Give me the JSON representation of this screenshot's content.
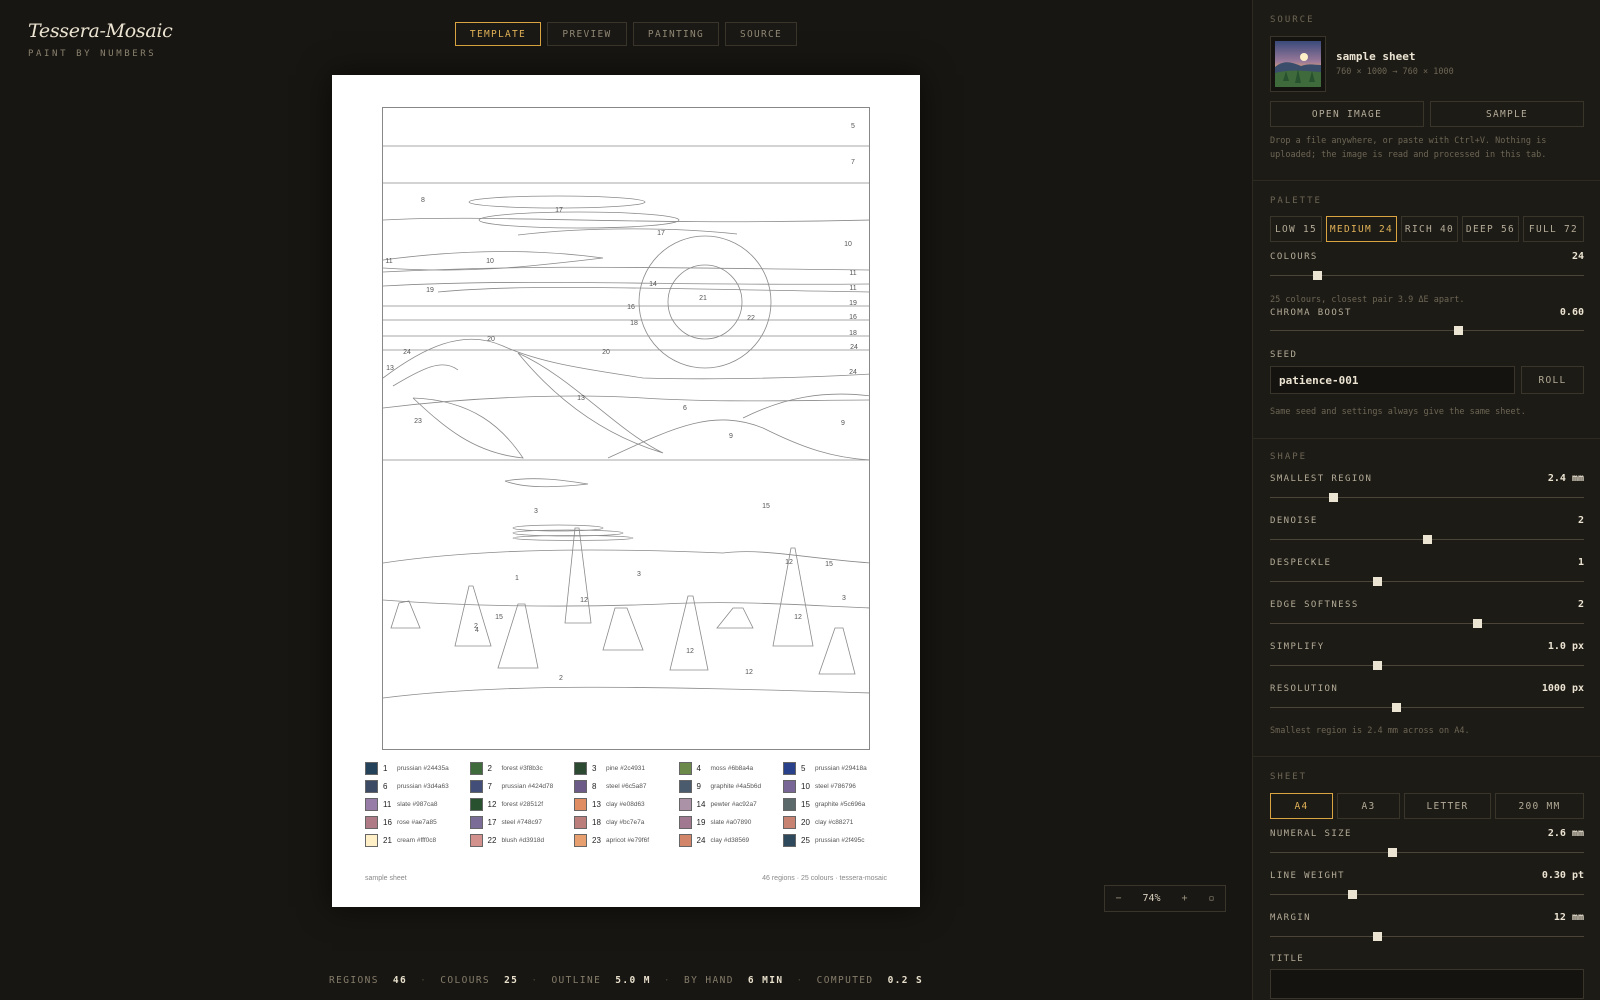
{
  "brand": {
    "title": "Tessera-Mosaic",
    "subtitle": "PAINT BY NUMBERS"
  },
  "tabs": [
    {
      "label": "TEMPLATE",
      "active": true
    },
    {
      "label": "PREVIEW",
      "active": false
    },
    {
      "label": "PAINTING",
      "active": false
    },
    {
      "label": "SOURCE",
      "active": false
    }
  ],
  "sheet": {
    "region_numbers": [
      "5",
      "7",
      "8",
      "17",
      "10",
      "11",
      "10",
      "11",
      "17",
      "14",
      "21",
      "11",
      "19",
      "19",
      "16",
      "16",
      "18",
      "18",
      "22",
      "20",
      "24",
      "24",
      "20",
      "13",
      "24",
      "13",
      "6",
      "23",
      "9",
      "9",
      "15",
      "1",
      "3",
      "3",
      "12",
      "15",
      "15",
      "2",
      "12",
      "12",
      "3",
      "12",
      "12",
      "2",
      "4"
    ],
    "legend": [
      {
        "num": "1",
        "label": "prussian #24435a",
        "color": "#24435a"
      },
      {
        "num": "2",
        "label": "forest #3f8b3c",
        "color": "#3f6b3c"
      },
      {
        "num": "3",
        "label": "pine #2c4931",
        "color": "#2c4931"
      },
      {
        "num": "4",
        "label": "moss #6b8a4a",
        "color": "#6b8a4a"
      },
      {
        "num": "5",
        "label": "prussian #29418a",
        "color": "#29418a"
      },
      {
        "num": "6",
        "label": "prussian #3d4a63",
        "color": "#3d4a63"
      },
      {
        "num": "7",
        "label": "prussian #424d78",
        "color": "#424d78"
      },
      {
        "num": "8",
        "label": "steel #6c5a87",
        "color": "#6c5a87"
      },
      {
        "num": "9",
        "label": "graphite #4a5b6d",
        "color": "#4a5b6d"
      },
      {
        "num": "10",
        "label": "steel #786796",
        "color": "#786796"
      },
      {
        "num": "11",
        "label": "slate #987ca8",
        "color": "#987ca8"
      },
      {
        "num": "12",
        "label": "forest #28512f",
        "color": "#28512f"
      },
      {
        "num": "13",
        "label": "clay #e08d63",
        "color": "#e08d63"
      },
      {
        "num": "14",
        "label": "pewter #ac92a7",
        "color": "#ac92a7"
      },
      {
        "num": "15",
        "label": "graphite #5c696a",
        "color": "#5c696a"
      },
      {
        "num": "16",
        "label": "rose #ae7a85",
        "color": "#ae7a85"
      },
      {
        "num": "17",
        "label": "steel #748c97",
        "color": "#7a6c97"
      },
      {
        "num": "18",
        "label": "clay #bc7e7a",
        "color": "#bc7e7a"
      },
      {
        "num": "19",
        "label": "slate #a07890",
        "color": "#a07890"
      },
      {
        "num": "20",
        "label": "clay #c88271",
        "color": "#c88271"
      },
      {
        "num": "21",
        "label": "cream #fff0c8",
        "color": "#fff0c8"
      },
      {
        "num": "22",
        "label": "blush #d3918d",
        "color": "#d3918d"
      },
      {
        "num": "23",
        "label": "apricot #e79f6f",
        "color": "#e79f6f"
      },
      {
        "num": "24",
        "label": "clay #d38569",
        "color": "#d38569"
      },
      {
        "num": "25",
        "label": "prussian #2f495c",
        "color": "#2f495c"
      }
    ],
    "footer_left": "sample sheet",
    "footer_right": "46 regions · 25 colours · tessera-mosaic"
  },
  "zoom": {
    "minus": "−",
    "value": "74%",
    "plus": "+",
    "fit": "▫"
  },
  "stats": [
    {
      "label": "REGIONS",
      "value": "46"
    },
    {
      "label": "COLOURS",
      "value": "25"
    },
    {
      "label": "OUTLINE",
      "value": "5.0 M"
    },
    {
      "label": "BY HAND",
      "value": "6 MIN"
    },
    {
      "label": "COMPUTED",
      "value": "0.2 S"
    }
  ],
  "panel": {
    "source": {
      "heading": "SOURCE",
      "name": "sample sheet",
      "dims": "760 × 1000 → 760 × 1000",
      "open_button": "OPEN IMAGE",
      "sample_button": "SAMPLE",
      "note": "Drop a file anywhere, or paste with Ctrl+V. Nothing is uploaded; the image is read and processed in this tab."
    },
    "palette": {
      "heading": "PALETTE",
      "presets": [
        {
          "label": "LOW 15",
          "active": false
        },
        {
          "label": "MEDIUM 24",
          "active": true
        },
        {
          "label": "RICH 40",
          "active": false
        },
        {
          "label": "DEEP 56",
          "active": false
        },
        {
          "label": "FULL 72",
          "active": false
        }
      ],
      "colours_label": "COLOURS",
      "colours_value": "24",
      "colours_level": 0.15,
      "colours_note": "25 colours, closest pair 3.9 ΔE apart.",
      "chroma_label": "CHROMA BOOST",
      "chroma_value": "0.60",
      "chroma_level": 0.6,
      "seed_label": "SEED",
      "seed_value": "patience-001",
      "roll_button": "ROLL",
      "seed_note": "Same seed and settings always give the same sheet."
    },
    "shape": {
      "heading": "SHAPE",
      "sliders": [
        {
          "label": "SMALLEST REGION",
          "value": "2.4 mm",
          "level": 0.2
        },
        {
          "label": "DENOISE",
          "value": "2",
          "level": 0.5
        },
        {
          "label": "DESPECKLE",
          "value": "1",
          "level": 0.34
        },
        {
          "label": "EDGE SOFTNESS",
          "value": "2",
          "level": 0.66
        },
        {
          "label": "SIMPLIFY",
          "value": "1.0 px",
          "level": 0.34
        },
        {
          "label": "RESOLUTION",
          "value": "1000 px",
          "level": 0.4
        }
      ],
      "note": "Smallest region is 2.4 mm across on A4."
    },
    "sheet": {
      "heading": "SHEET",
      "sizes": [
        {
          "label": "A4",
          "active": true
        },
        {
          "label": "A3",
          "active": false
        },
        {
          "label": "LETTER",
          "active": false
        },
        {
          "label": "200 MM",
          "active": false
        }
      ],
      "sliders": [
        {
          "label": "NUMERAL SIZE",
          "value": "2.6 mm",
          "level": 0.39
        },
        {
          "label": "LINE WEIGHT",
          "value": "0.30 pt",
          "level": 0.26
        },
        {
          "label": "MARGIN",
          "value": "12 mm",
          "level": 0.34
        }
      ],
      "title_label": "TITLE"
    }
  },
  "colors": {
    "accent": "#d9a441",
    "background": "#181612",
    "panel": "#1d1b16",
    "sheet": "#ffffff"
  }
}
